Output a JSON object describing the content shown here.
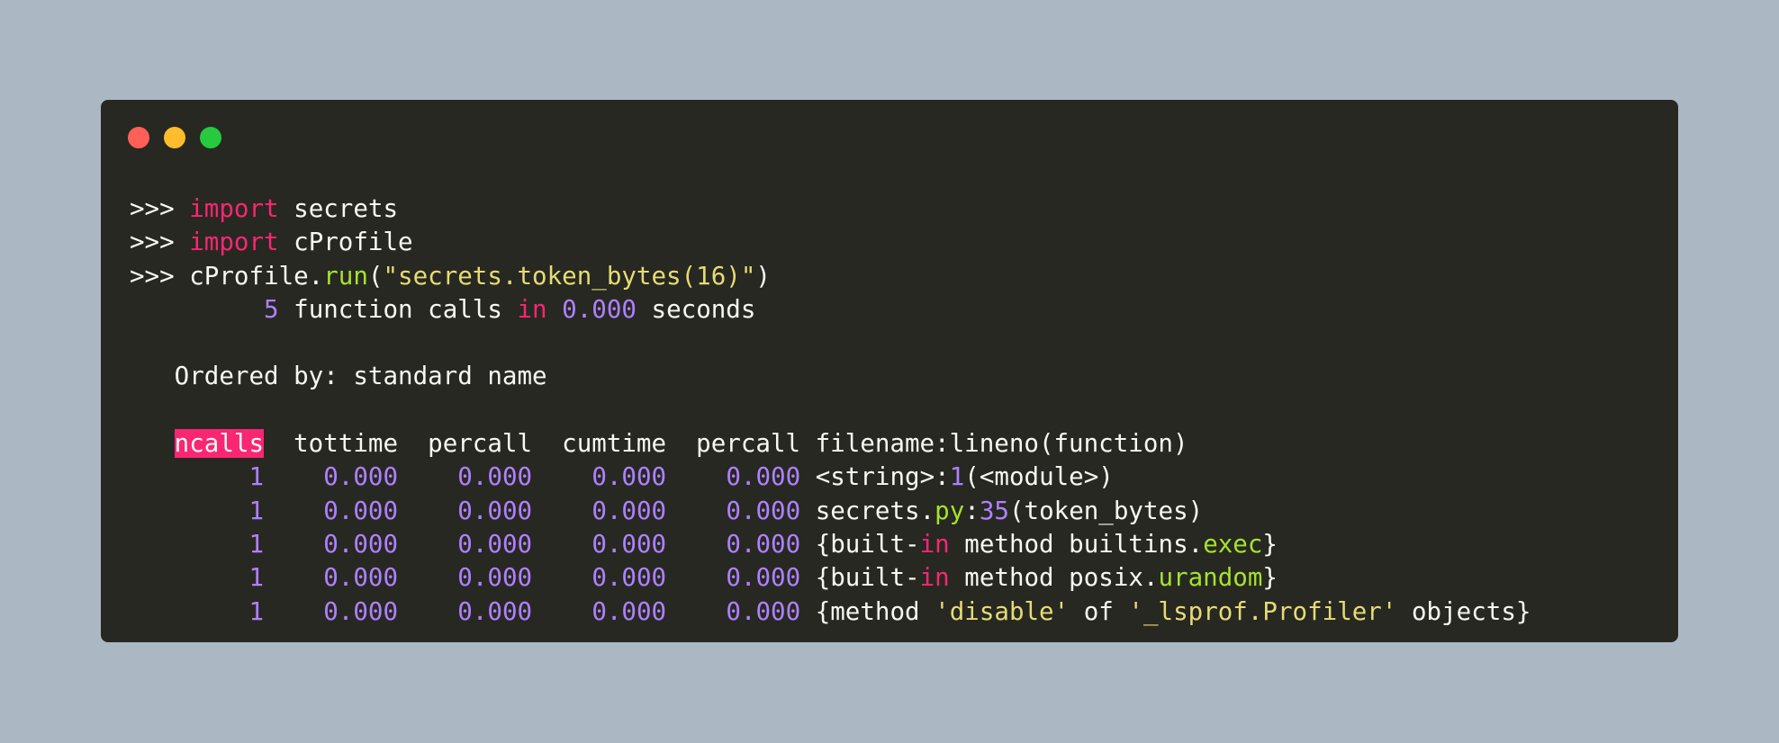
{
  "window": {
    "buttons": [
      "close",
      "minimize",
      "maximize"
    ]
  },
  "colors": {
    "background": "#abb8c3",
    "terminal_bg": "#272822",
    "text": "#f8f8f2",
    "keyword": "#f92672",
    "number": "#ae81ff",
    "string": "#e6db74",
    "function": "#a6e22e",
    "dot_red": "#ff5f56",
    "dot_yellow": "#ffbd2e",
    "dot_green": "#27c93f"
  },
  "lines": [
    [
      {
        "t": ">>> "
      },
      {
        "t": "import",
        "c": "kw"
      },
      {
        "t": " secrets"
      }
    ],
    [
      {
        "t": ">>> "
      },
      {
        "t": "import",
        "c": "kw"
      },
      {
        "t": " cProfile"
      }
    ],
    [
      {
        "t": ">>> cProfile."
      },
      {
        "t": "run",
        "c": "fn"
      },
      {
        "t": "("
      },
      {
        "t": "\"secrets.token_bytes(16)\"",
        "c": "str"
      },
      {
        "t": ")"
      }
    ],
    [
      {
        "t": "         "
      },
      {
        "t": "5",
        "c": "num"
      },
      {
        "t": " function calls "
      },
      {
        "t": "in",
        "c": "kw"
      },
      {
        "t": " "
      },
      {
        "t": "0.000",
        "c": "num"
      },
      {
        "t": " seconds"
      }
    ],
    [
      {
        "t": ""
      }
    ],
    [
      {
        "t": "   Ordered by: standard name"
      }
    ],
    [
      {
        "t": ""
      }
    ],
    [
      {
        "t": "   "
      },
      {
        "t": "ncalls",
        "c": "hl"
      },
      {
        "t": "  tottime  percall  cumtime  percall filename:lineno(function)"
      }
    ],
    [
      {
        "t": "        "
      },
      {
        "t": "1",
        "c": "num"
      },
      {
        "t": "    "
      },
      {
        "t": "0.000",
        "c": "num"
      },
      {
        "t": "    "
      },
      {
        "t": "0.000",
        "c": "num"
      },
      {
        "t": "    "
      },
      {
        "t": "0.000",
        "c": "num"
      },
      {
        "t": "    "
      },
      {
        "t": "0.000",
        "c": "num"
      },
      {
        "t": " <string>:"
      },
      {
        "t": "1",
        "c": "num"
      },
      {
        "t": "(<module>)"
      }
    ],
    [
      {
        "t": "        "
      },
      {
        "t": "1",
        "c": "num"
      },
      {
        "t": "    "
      },
      {
        "t": "0.000",
        "c": "num"
      },
      {
        "t": "    "
      },
      {
        "t": "0.000",
        "c": "num"
      },
      {
        "t": "    "
      },
      {
        "t": "0.000",
        "c": "num"
      },
      {
        "t": "    "
      },
      {
        "t": "0.000",
        "c": "num"
      },
      {
        "t": " secrets."
      },
      {
        "t": "py",
        "c": "fn"
      },
      {
        "t": ":"
      },
      {
        "t": "35",
        "c": "num"
      },
      {
        "t": "(token_bytes)"
      }
    ],
    [
      {
        "t": "        "
      },
      {
        "t": "1",
        "c": "num"
      },
      {
        "t": "    "
      },
      {
        "t": "0.000",
        "c": "num"
      },
      {
        "t": "    "
      },
      {
        "t": "0.000",
        "c": "num"
      },
      {
        "t": "    "
      },
      {
        "t": "0.000",
        "c": "num"
      },
      {
        "t": "    "
      },
      {
        "t": "0.000",
        "c": "num"
      },
      {
        "t": " {built-"
      },
      {
        "t": "in",
        "c": "kw"
      },
      {
        "t": " method builtins."
      },
      {
        "t": "exec",
        "c": "fn"
      },
      {
        "t": "}"
      }
    ],
    [
      {
        "t": "        "
      },
      {
        "t": "1",
        "c": "num"
      },
      {
        "t": "    "
      },
      {
        "t": "0.000",
        "c": "num"
      },
      {
        "t": "    "
      },
      {
        "t": "0.000",
        "c": "num"
      },
      {
        "t": "    "
      },
      {
        "t": "0.000",
        "c": "num"
      },
      {
        "t": "    "
      },
      {
        "t": "0.000",
        "c": "num"
      },
      {
        "t": " {built-"
      },
      {
        "t": "in",
        "c": "kw"
      },
      {
        "t": " method posix."
      },
      {
        "t": "urandom",
        "c": "fn"
      },
      {
        "t": "}"
      }
    ],
    [
      {
        "t": "        "
      },
      {
        "t": "1",
        "c": "num"
      },
      {
        "t": "    "
      },
      {
        "t": "0.000",
        "c": "num"
      },
      {
        "t": "    "
      },
      {
        "t": "0.000",
        "c": "num"
      },
      {
        "t": "    "
      },
      {
        "t": "0.000",
        "c": "num"
      },
      {
        "t": "    "
      },
      {
        "t": "0.000",
        "c": "num"
      },
      {
        "t": " {method "
      },
      {
        "t": "'disable'",
        "c": "str"
      },
      {
        "t": " of "
      },
      {
        "t": "'_lsprof.Profiler'",
        "c": "str"
      },
      {
        "t": " objects}"
      }
    ]
  ]
}
